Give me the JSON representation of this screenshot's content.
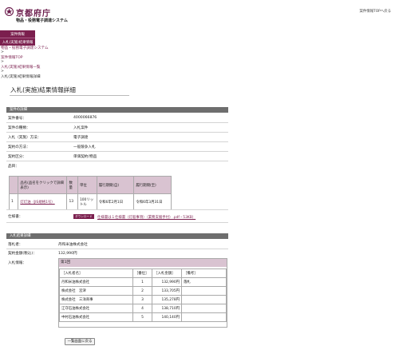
{
  "header": {
    "logo_text": "京都府庁",
    "system_name": "物品・役務電子調達システム",
    "top_link": "案件情報TOPへ戻る"
  },
  "nav": [
    "案件情報",
    "入札(実施)結果情報"
  ],
  "breadcrumb": {
    "item1": "物品・役務電子調達システム",
    "sep": ">",
    "item2": "案件情報TOP",
    "item3": "入札(実施)結果情報一覧",
    "current": "入札(実施)結果情報詳細"
  },
  "page_title": "入札(実施)結果情報詳細",
  "case_section": {
    "heading": "案件の詳細",
    "rows": [
      {
        "label": "案件番号：",
        "value": "4000066876"
      },
      {
        "label": "案件の種類：",
        "value": "入札案件"
      },
      {
        "label": "入札（実施）方法：",
        "value": "電子調達"
      },
      {
        "label": "契約の方法：",
        "value": "一般競争入札"
      },
      {
        "label": "契約区分：",
        "value": "単価契約(物品"
      }
    ],
    "items_label": "品目：",
    "items_table": {
      "headers": [
        "",
        "品名(品名をクリックで詳細表示)",
        "数量",
        "単位",
        "履行期間(自)",
        "履行期間(至)"
      ],
      "rows": [
        {
          "no": "1",
          "name": "灯灯油（JIS規格1号）",
          "qty": "13",
          "unit": "100リットル",
          "from": "令和6年2月1日",
          "to": "令和6年3月31日"
        }
      ]
    },
    "spec_label": "仕様書：",
    "download_badge": "ダウンロード",
    "spec_link": "仕様書は１仕様書（灯般事項）（業務支援手付）.pdf・53KB）"
  },
  "result_section": {
    "heading": "入札結果詳細",
    "winner_label": "落札者：",
    "winner": "丹和米油株式会社",
    "amount_label": "契約金額(税込)：",
    "amount": "132,990円",
    "bid_info_label": "入札情報：",
    "round": "第1回",
    "bid_headers": [
      "［入札者名］",
      "［番位］",
      "［入札金額］",
      "［備考］"
    ],
    "bids": [
      {
        "name": "丹和米油株式会社",
        "rank": "1",
        "amount": "132,990円",
        "note": "落札"
      },
      {
        "name": "株式会社　宮津",
        "rank": "2",
        "amount": "133,705円",
        "note": ""
      },
      {
        "name": "株式会社　三洋商事",
        "rank": "3",
        "amount": "135,278円",
        "note": ""
      },
      {
        "name": "江守石油株式会社",
        "rank": "4",
        "amount": "138,710円",
        "note": ""
      },
      {
        "name": "中村石油株式会社",
        "rank": "5",
        "amount": "140,140円",
        "note": ""
      }
    ]
  },
  "back_button": "一覧画面に戻る",
  "colors": {
    "brand": "#7b1f4e",
    "section_header": "#6e6e6e",
    "table_header": "#d9c3d1"
  }
}
